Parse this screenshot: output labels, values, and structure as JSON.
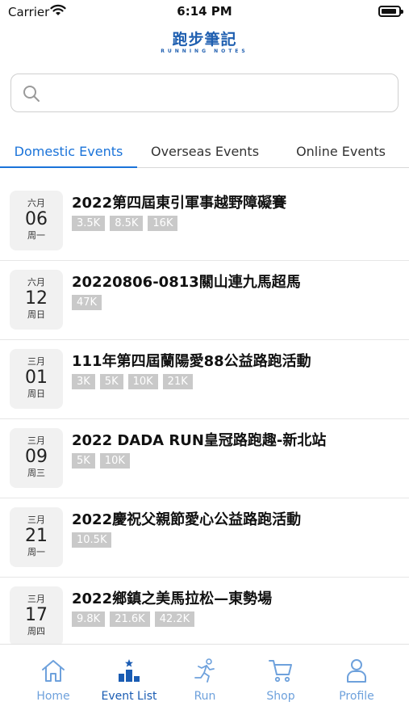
{
  "status_bar": {
    "carrier": "Carrier",
    "time": "6:14 PM"
  },
  "logo": {
    "title": "跑步筆記",
    "subtitle": "RUNNING NOTES"
  },
  "search": {
    "placeholder": "",
    "value": ""
  },
  "tabs": [
    {
      "label": "Domestic Events",
      "active": true
    },
    {
      "label": "Overseas Events",
      "active": false
    },
    {
      "label": "Online Events",
      "active": false
    }
  ],
  "events": [
    {
      "month": "六月",
      "day": "06",
      "weekday": "周一",
      "title": "2022第四屆東引軍事越野障礙賽",
      "tags": [
        "3.5K",
        "8.5K",
        "16K"
      ]
    },
    {
      "month": "六月",
      "day": "12",
      "weekday": "周日",
      "title": "20220806-0813關山連九馬超馬",
      "tags": [
        "47K"
      ]
    },
    {
      "month": "三月",
      "day": "01",
      "weekday": "周日",
      "title": "111年第四屆蘭陽愛88公益路跑活動",
      "tags": [
        "3K",
        "5K",
        "10K",
        "21K"
      ]
    },
    {
      "month": "三月",
      "day": "09",
      "weekday": "周三",
      "title": "2022 DADA RUN皇冠路跑趣-新北站",
      "tags": [
        "5K",
        "10K"
      ]
    },
    {
      "month": "三月",
      "day": "21",
      "weekday": "周一",
      "title": "2022慶祝父親節愛心公益路跑活動",
      "tags": [
        "10.5K"
      ]
    },
    {
      "month": "三月",
      "day": "17",
      "weekday": "周四",
      "title": "2022鄉鎮之美馬拉松—東勢場",
      "tags": [
        "9.8K",
        "21.6K",
        "42.2K"
      ]
    }
  ],
  "nav": {
    "home": {
      "label": "Home",
      "icon": "home-icon"
    },
    "event_list": {
      "label": "Event List",
      "icon": "podium-icon"
    },
    "run": {
      "label": "Run",
      "icon": "runner-icon"
    },
    "shop": {
      "label": "Shop",
      "icon": "cart-icon"
    },
    "profile": {
      "label": "Profile",
      "icon": "person-icon"
    }
  },
  "colors": {
    "accent": "#1a73d9",
    "nav_inactive": "#6ea1dc",
    "nav_active": "#1a5cb3",
    "tag_bg": "#c9c9c9"
  }
}
